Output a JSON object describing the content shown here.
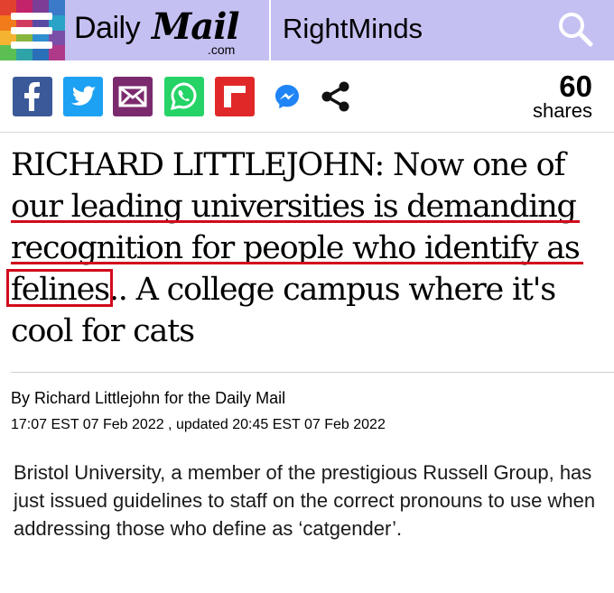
{
  "header": {
    "brand_daily": "Daily",
    "brand_mail": "Mail",
    "brand_domain": ".com",
    "section": "RightMinds",
    "search_icon": "search-icon",
    "menu_icon": "hamburger-icon"
  },
  "colors": {
    "header_bg": "#c4c0f2",
    "facebook": "#3b5998",
    "twitter": "#1da1f2",
    "email": "#7b2a6e",
    "whatsapp": "#25d366",
    "flipboard": "#e12828",
    "messenger": "#0084ff",
    "annotation_red": "#d10b1c"
  },
  "share_bar": {
    "icons": [
      "facebook-icon",
      "twitter-icon",
      "email-icon",
      "whatsapp-icon",
      "flipboard-icon",
      "messenger-icon",
      "share-icon"
    ],
    "count": "60",
    "count_label": "shares"
  },
  "article": {
    "headline_lines": [
      "RICHARD LITTLEJOHN: Now one of",
      "our leading universities is demanding",
      "recognition for people who identify as",
      "felines",
      ".. A college campus where it's",
      "cool for cats"
    ],
    "byline": "By Richard Littlejohn for the Daily Mail",
    "dateline": "17:07 EST 07 Feb 2022 , updated 20:45 EST 07 Feb 2022",
    "body": "Bristol University, a member of the prestigious Russell Group, has just issued guidelines to staff on the correct pronouns to use when addressing those who define as ‘catgender’."
  }
}
